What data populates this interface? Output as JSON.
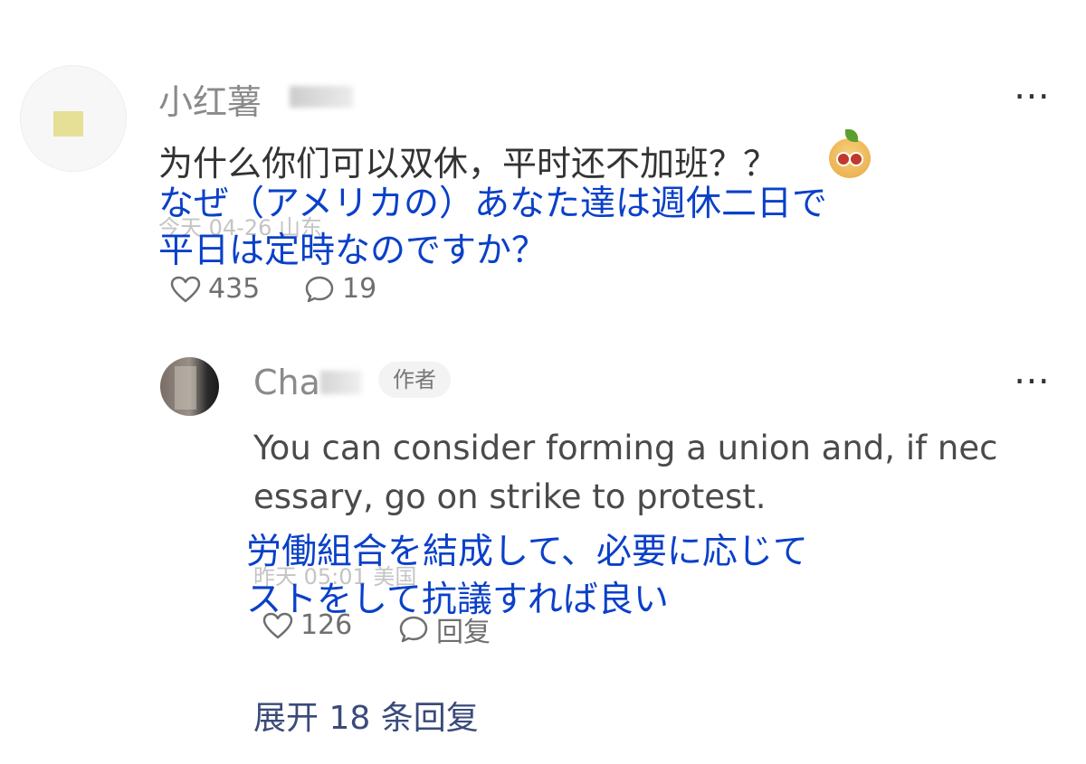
{
  "comment": {
    "username": "小红薯",
    "text": "为什么你们可以双休，平时还不加班？？",
    "meta": "今天 04-26 山东",
    "likes": "435",
    "replies": "19",
    "translation_line1": "なぜ（アメリカの）あなた達は週休二日で",
    "translation_line2": "平日は定時なのですか？",
    "emoji_icon": "peach-face-emoji-icon"
  },
  "reply": {
    "username": "Cha",
    "badge": "作者",
    "text_line1": "You can consider forming a union and, if nec",
    "text_line2": "essary, go on strike to protest.",
    "meta": "昨天 05:01 美国",
    "likes": "126",
    "reply_label": "回复",
    "translation_line1": "労働組合を結成して、必要に応じて",
    "translation_line2": "ストをして抗議すれば良い"
  },
  "expand_replies": "展开 18 条回复",
  "colors": {
    "overlay_text": "#0a40c9",
    "body_text": "#333333",
    "muted_text": "#8a8a8a"
  }
}
